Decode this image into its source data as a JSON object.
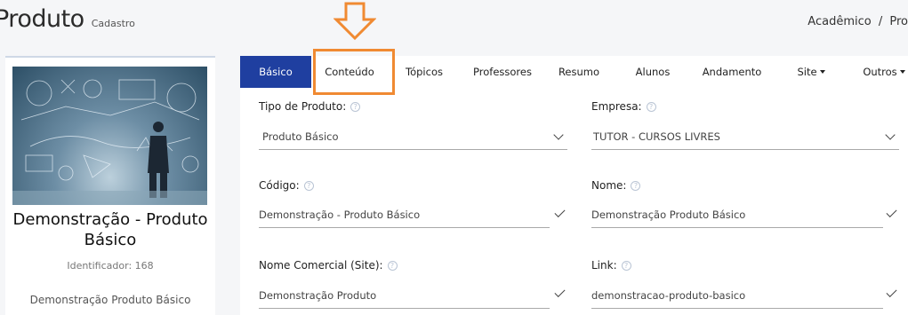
{
  "header": {
    "title": "Produto",
    "subtitle": "Cadastro",
    "breadcrumb": [
      "Acadêmico",
      "/",
      "Pro"
    ]
  },
  "left_card": {
    "name": "Demonstração - Produto Básico",
    "identifier": "Identificador: 168",
    "description": "Demonstração Produto Básico"
  },
  "tabs": [
    {
      "label": "Básico",
      "active": true
    },
    {
      "label": "Conteúdo"
    },
    {
      "label": "Tópicos"
    },
    {
      "label": "Professores"
    },
    {
      "label": "Resumo"
    },
    {
      "label": "Alunos"
    },
    {
      "label": "Andamento"
    },
    {
      "label": "Site",
      "dropdown": true
    },
    {
      "label": "Outros",
      "dropdown": true
    }
  ],
  "form": {
    "tipo_produto": {
      "label": "Tipo de Produto:",
      "value": "Produto Básico"
    },
    "empresa": {
      "label": "Empresa:",
      "value": "TUTOR - CURSOS LIVRES"
    },
    "codigo": {
      "label": "Código:",
      "value": "Demonstração - Produto Básico"
    },
    "nome": {
      "label": "Nome:",
      "value": "Demonstração Produto Básico"
    },
    "nome_comercial": {
      "label": "Nome Comercial (Site):",
      "value": "Demonstração Produto"
    },
    "link": {
      "label": "Link:",
      "value": "demonstracao-produto-basico"
    }
  },
  "colors": {
    "active_tab": "#1f3fa0",
    "highlight": "#f08a32"
  },
  "icons": [
    "help-icon",
    "chevron-down-icon",
    "check-icon",
    "arrow-down-icon"
  ]
}
